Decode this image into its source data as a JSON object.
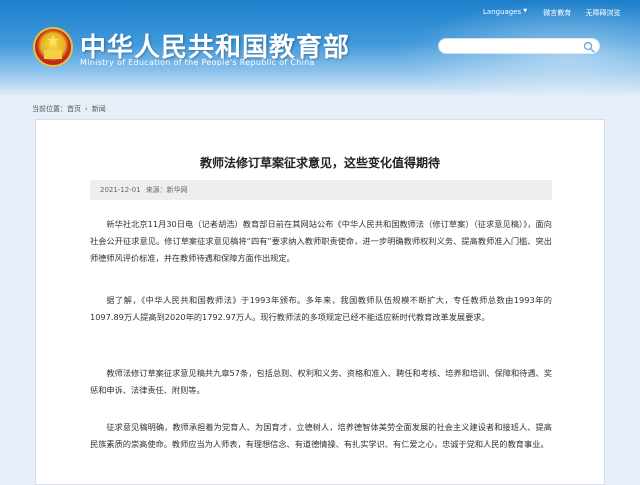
{
  "header": {
    "title": "中华人民共和国教育部",
    "subtitle": "Ministry of Education of the People's Republic of China",
    "links": {
      "languages": "Languages",
      "weibo": "微言教育",
      "accessibility": "无障碍浏览"
    },
    "search": {
      "placeholder": ""
    }
  },
  "breadcrumb": {
    "prefix": "当前位置：",
    "home": "首页",
    "current": "新闻",
    "separator": "›"
  },
  "article": {
    "title": "教师法修订草案征求意见，这些变化值得期待",
    "date": "2021-12-01",
    "source": "来源：新华网",
    "paragraphs": [
      "新华社北京11月30日电（记者胡浩）教育部日前在其网站公布《中华人民共和国教师法（修订草案）（征求意见稿）》，面向社会公开征求意见。修订草案征求意见稿将“四有”要求纳入教师职责使命，进一步明确教师权利义务、提高教师准入门槛、突出师德师风评价标准，并在教师待遇和保障方面作出规定。",
      "据了解，《中华人民共和国教师法》于1993年颁布。多年来，我国教师队伍规模不断扩大，专任教师总数由1993年的1097.89万人提高到2020年的1792.97万人。现行教师法的多项规定已经不能适应新时代教育改革发展要求。",
      "教师法修订草案征求意见稿共九章57条，包括总则、权利和义务、资格和准入、聘任和考核、培养和培训、保障和待遇、奖惩和申诉、法律责任、附则等。",
      "征求意见稿明确，教师承担着为党育人、为国育才，立德树人，培养德智体美劳全面发展的社会主义建设者和接班人、提高民族素质的崇高使命。教师应当为人师表，有理想信念、有道德情操、有扎实学识、有仁爱之心，忠诚于党和人民的教育事业。"
    ]
  },
  "colors": {
    "header_blue": "#1d7fcb",
    "page_bg": "#e6eff8",
    "meta_bg": "#eeeeee"
  },
  "icons": [
    "national-emblem-icon",
    "search-icon",
    "chevron-down-icon"
  ]
}
